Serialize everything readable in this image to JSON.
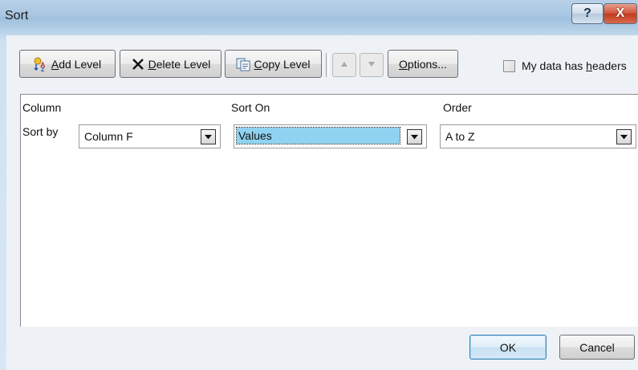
{
  "window": {
    "title": "Sort",
    "help_label": "?",
    "close_label": "X"
  },
  "toolbar": {
    "add_level": {
      "mnemonic": "A",
      "rest": "dd Level"
    },
    "delete_level": {
      "mnemonic": "D",
      "rest": "elete Level"
    },
    "copy_level": {
      "mnemonic": "C",
      "rest": "opy Level"
    },
    "options": {
      "mnemonic": "O",
      "rest": "ptions..."
    },
    "headers_checkbox": {
      "label_pre": "My data has ",
      "mnemonic": "h",
      "label_post": "eaders",
      "checked": false
    }
  },
  "grid": {
    "headers": {
      "column": "Column",
      "sort_on": "Sort On",
      "order": "Order"
    },
    "rows": [
      {
        "label": "Sort by",
        "column": "Column F",
        "sort_on": "Values",
        "order": "A to Z"
      }
    ]
  },
  "footer": {
    "ok_label": "OK",
    "cancel_label": "Cancel"
  },
  "icons": {
    "add_level": "add-level-icon",
    "delete_level": "delete-x-icon",
    "copy_level": "copy-level-icon",
    "move_up": "triangle-up-icon",
    "move_down": "triangle-down-icon",
    "dropdown": "chevron-down-icon"
  },
  "colors": {
    "title_bg": "#a9c7e2",
    "close_red": "#c23b1e",
    "selection_highlight": "#8fd3f0",
    "default_button_border": "#3c7fb1"
  }
}
